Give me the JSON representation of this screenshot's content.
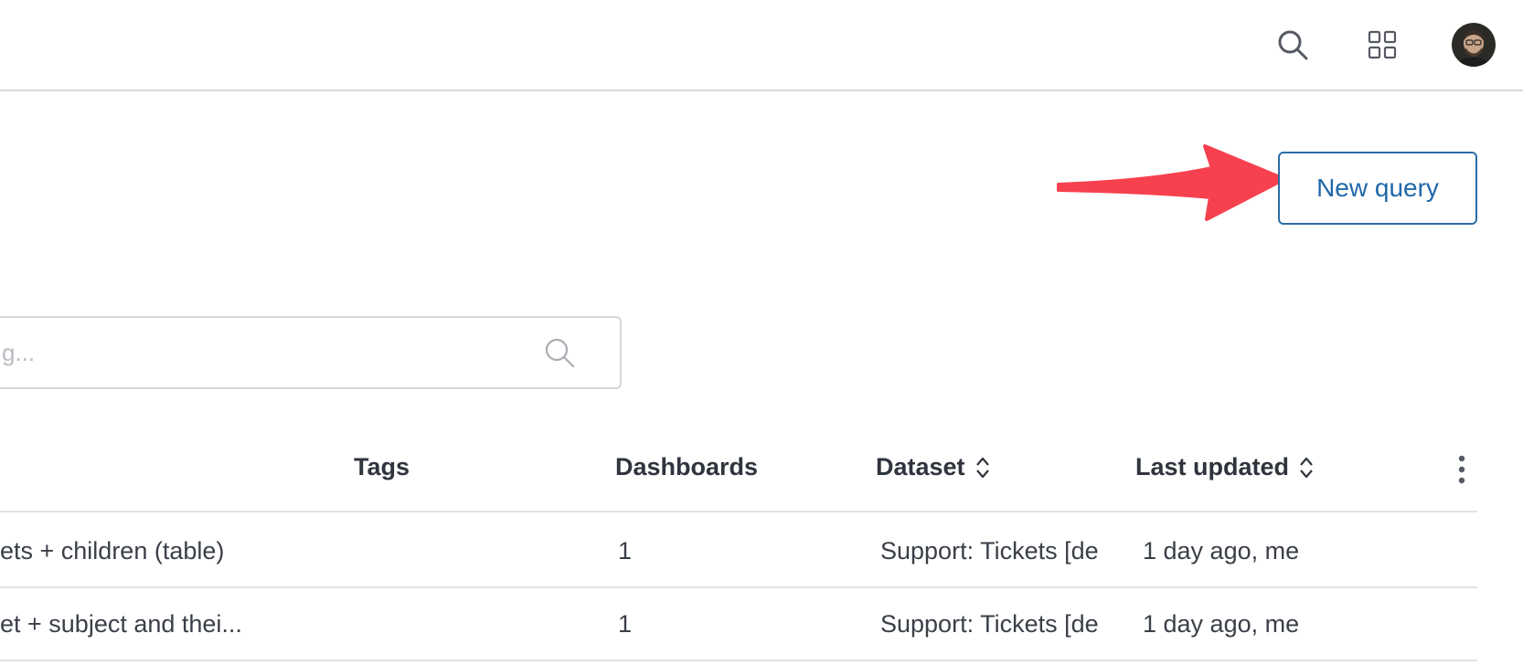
{
  "header": {
    "search_icon": "search-icon",
    "apps_icon": "grid-icon",
    "avatar": "user-avatar"
  },
  "actions": {
    "new_query_label": "New query"
  },
  "search": {
    "placeholder": "g..."
  },
  "table": {
    "columns": [
      "Tags",
      "Dashboards",
      "Dataset",
      "Last updated"
    ],
    "rows": [
      {
        "name": "ets + children (table)",
        "dashboards": "1",
        "dataset": "Support: Tickets [de",
        "last_updated": "1 day ago, me"
      },
      {
        "name": "et + subject and thei...",
        "dashboards": "1",
        "dataset": "Support: Tickets [de",
        "last_updated": "1 day ago, me"
      }
    ]
  },
  "colors": {
    "accent": "#1f68a9",
    "annotation_arrow": "#f7414f"
  }
}
